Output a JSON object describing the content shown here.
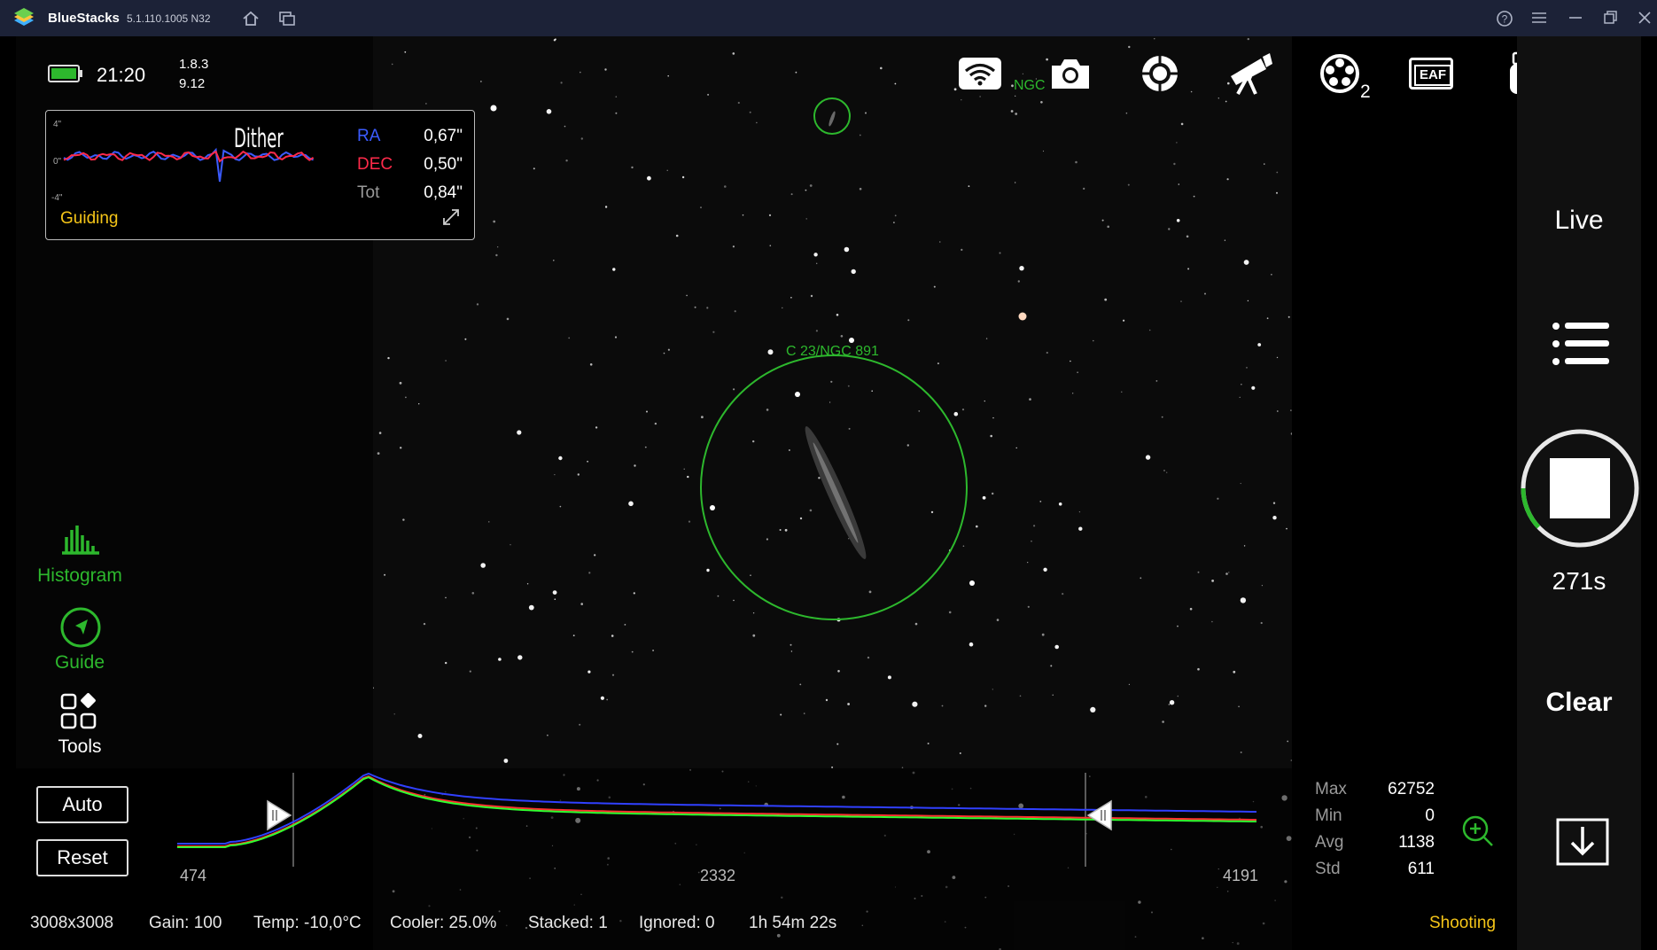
{
  "titlebar": {
    "app_name": "BlueStacks",
    "version": "5.1.110.1005  N32"
  },
  "device": {
    "time": "21:20",
    "ver_a": "1.8.3",
    "ver_b": "9.12"
  },
  "guiding": {
    "dither_label": "Dither",
    "ra_label": "RA",
    "ra_value": "0,67\"",
    "dec_label": "DEC",
    "dec_value": "0,50\"",
    "tot_label": "Tot",
    "tot_value": "0,84\"",
    "axis_top": "4\"",
    "axis_mid": "0\"",
    "axis_bot": "-4\"",
    "status": "Guiding",
    "colors": {
      "ra": "#3b5bff",
      "dec": "#ff2a4a",
      "status": "#f5c518"
    }
  },
  "sidebar": [
    {
      "label": "Histogram",
      "icon": "histogram-icon"
    },
    {
      "label": "Guide",
      "icon": "guide-icon"
    },
    {
      "label": "Tools",
      "icon": "tools-icon"
    }
  ],
  "top_icons": [
    "wifi-icon",
    "camera-icon",
    "target-icon",
    "telescope-icon",
    "filter-wheel-icon",
    "eaf-icon",
    "usb-drive-icon",
    "info-icon"
  ],
  "filter_wheel_position": "2",
  "eaf_label": "EAF",
  "annotations": {
    "main_object": "C 23/NGC 891",
    "small_object": "NGC"
  },
  "controls": {
    "live": "Live",
    "exposure": "271s",
    "clear": "Clear",
    "progress_fraction": 0.12
  },
  "histogram": {
    "auto": "Auto",
    "reset": "Reset",
    "min_label": "474",
    "mid_label": "2332",
    "max_label": "4191"
  },
  "stats": {
    "max_label": "Max",
    "max_value": "62752",
    "min_label": "Min",
    "min_value": "0",
    "avg_label": "Avg",
    "avg_value": "1138",
    "std_label": "Std",
    "std_value": "611"
  },
  "statusbar": {
    "resolution": "3008x3008",
    "gain": "Gain: 100",
    "temp": "Temp: -10,0°C",
    "cooler": "Cooler: 25.0%",
    "stacked": "Stacked: 1",
    "ignored": "Ignored: 0",
    "elapsed": "1h 54m 22s",
    "state": "Shooting"
  },
  "accent": "#2db82d"
}
